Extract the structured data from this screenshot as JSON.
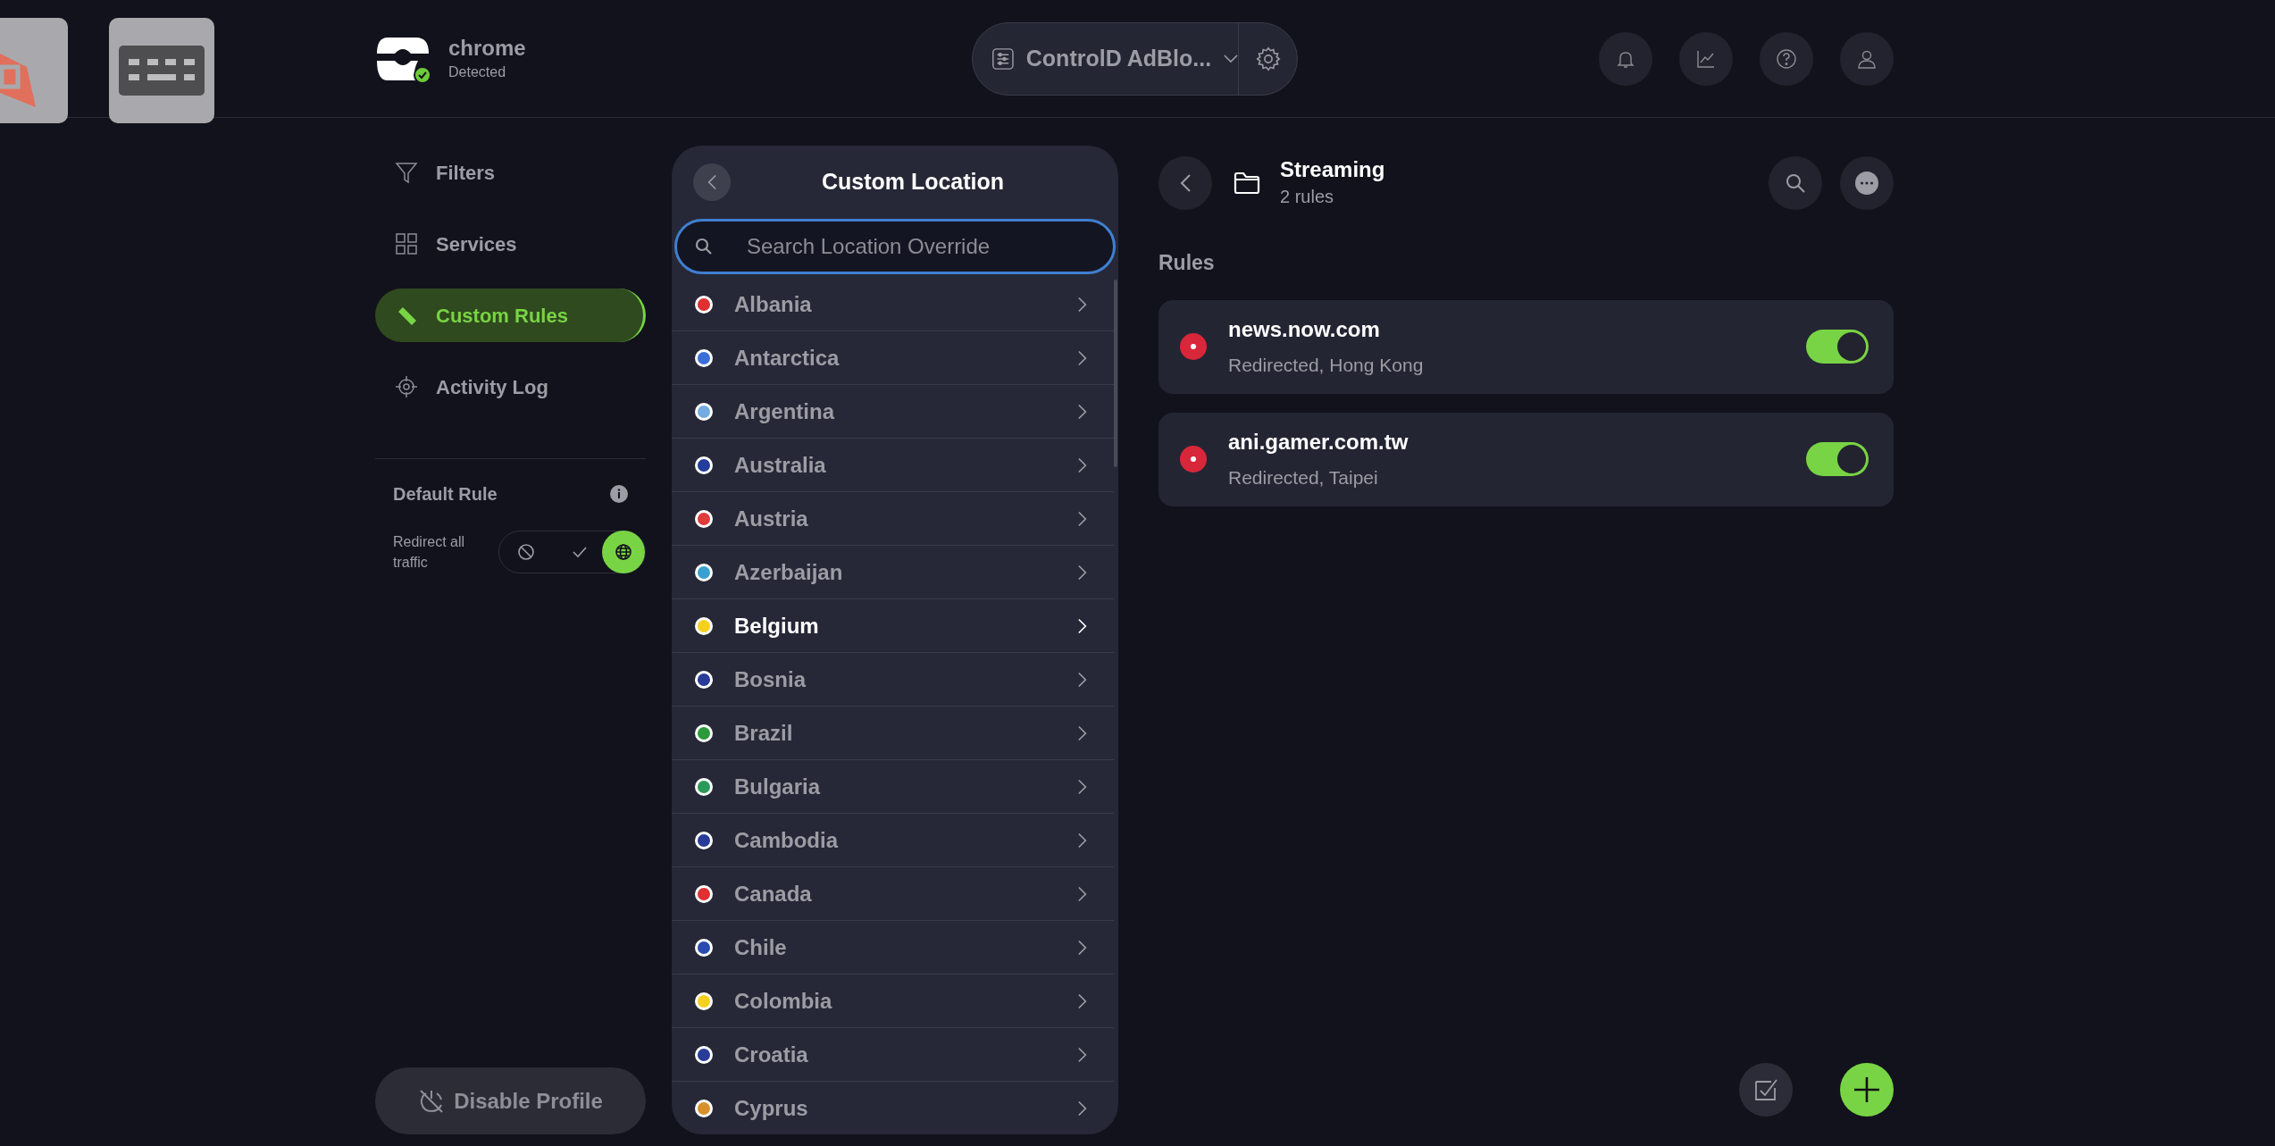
{
  "device": {
    "name": "chrome",
    "status": "Detected"
  },
  "profile": {
    "name": "ControlD AdBlo..."
  },
  "sidebar": {
    "items": [
      {
        "label": "Filters",
        "kind": "filter",
        "selected": false
      },
      {
        "label": "Services",
        "kind": "grid",
        "selected": false
      },
      {
        "label": "Custom Rules",
        "kind": "pencil",
        "selected": true
      },
      {
        "label": "Activity Log",
        "kind": "target",
        "selected": false
      }
    ],
    "default_rule": {
      "title": "Default Rule",
      "label": "Redirect all traffic",
      "options": [
        {
          "kind": "block",
          "selected": false
        },
        {
          "kind": "allow",
          "selected": false
        },
        {
          "kind": "redirect",
          "selected": true
        }
      ]
    },
    "disable_button": "Disable Profile"
  },
  "location_panel": {
    "title": "Custom Location",
    "search": {
      "placeholder": "Search Location Override"
    },
    "countries": [
      {
        "name": "Albania",
        "color": "#e03030",
        "selected": false
      },
      {
        "name": "Antarctica",
        "color": "#3a6fd8",
        "selected": false
      },
      {
        "name": "Argentina",
        "color": "#74acdf",
        "selected": false
      },
      {
        "name": "Australia",
        "color": "#243c9c",
        "selected": false
      },
      {
        "name": "Austria",
        "color": "#e03a3a",
        "selected": false
      },
      {
        "name": "Azerbaijan",
        "color": "#3aa0d0",
        "selected": false
      },
      {
        "name": "Belgium",
        "color": "#f5d020",
        "selected": true
      },
      {
        "name": "Bosnia",
        "color": "#2a3c9a",
        "selected": false
      },
      {
        "name": "Brazil",
        "color": "#2a9a3a",
        "selected": false
      },
      {
        "name": "Bulgaria",
        "color": "#2a9a5a",
        "selected": false
      },
      {
        "name": "Cambodia",
        "color": "#2a3c9a",
        "selected": false
      },
      {
        "name": "Canada",
        "color": "#e03030",
        "selected": false
      },
      {
        "name": "Chile",
        "color": "#2a4cb0",
        "selected": false
      },
      {
        "name": "Colombia",
        "color": "#f5d020",
        "selected": false
      },
      {
        "name": "Croatia",
        "color": "#2a3c9a",
        "selected": false
      },
      {
        "name": "Cyprus",
        "color": "#d8902a",
        "selected": false
      }
    ]
  },
  "folder": {
    "title": "Streaming",
    "count": "2 rules",
    "section": "Rules",
    "rules": [
      {
        "domain": "news.now.com",
        "detail": "Redirected, Hong Kong",
        "color": "#d8263a",
        "on": true
      },
      {
        "domain": "ani.gamer.com.tw",
        "detail": "Redirected, Taipei",
        "color": "#d8263a",
        "on": true
      }
    ]
  }
}
